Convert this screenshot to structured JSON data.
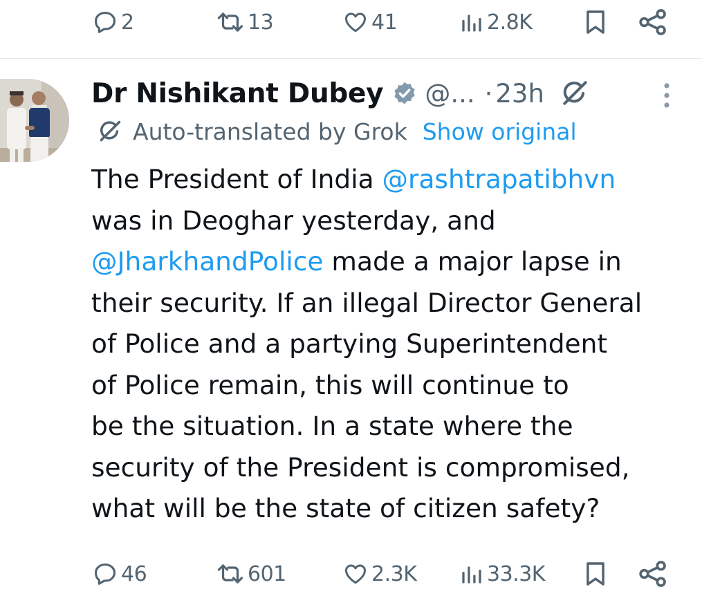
{
  "previous_tweet": {
    "actions": {
      "replies": "2",
      "reposts": "13",
      "likes": "41",
      "views": "2.8K"
    }
  },
  "tweet": {
    "author": {
      "display_name": "Dr Nishikant Dubey",
      "handle": "@...",
      "verified": true
    },
    "separator": "·",
    "timestamp": "23h",
    "translation": {
      "label": "Auto-translated by Grok",
      "show_original": "Show original"
    },
    "body": {
      "l1_text": "The President of India ",
      "l1_mention": "@rashtrapatibhvn",
      "l2_text": "was in Deoghar yesterday, and",
      "l3_mention": "@JharkhandPolice",
      "l3_text": " made a major lapse in",
      "l4_text": "their security. If an illegal Director General",
      "l5_text": "of Police and a partying Superintendent",
      "l6_text": "of Police remain, this will continue to",
      "l7_text": "be the situation. In a state where the",
      "l8_text": "security of the President is compromised,",
      "l9_text": "what will be the state of citizen safety?"
    },
    "actions": {
      "replies": "46",
      "reposts": "601",
      "likes": "2.3K",
      "views": "33.3K"
    }
  },
  "colors": {
    "text_primary": "#0f1419",
    "text_secondary": "#536471",
    "link": "#1d9bf0",
    "divider": "#e6e9eb",
    "verified_badge": "#829aab"
  },
  "icons": {
    "reply": "reply-icon",
    "repost": "repost-icon",
    "like": "heart-icon",
    "views": "views-icon",
    "bookmark": "bookmark-icon",
    "share": "share-icon",
    "grok": "grok-icon",
    "more": "more-icon",
    "verified": "verified-badge-icon"
  }
}
